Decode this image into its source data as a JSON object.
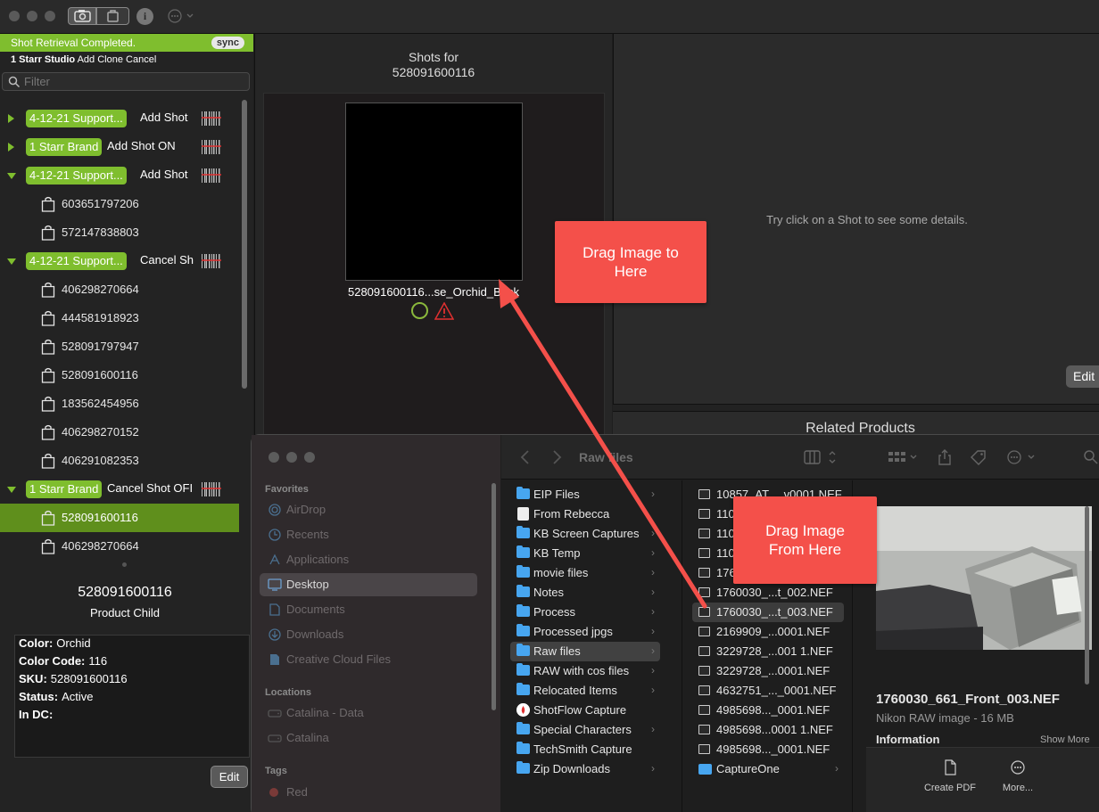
{
  "left": {
    "status": "Shot Retrieval Completed.",
    "sync_label": "sync",
    "studio": {
      "name": "1 Starr Studio",
      "add": "Add",
      "clone": "Clone",
      "cancel": "Cancel"
    },
    "filter_placeholder": "Filter",
    "tree": [
      {
        "type": "group",
        "badge": "4-12-21 Support...",
        "action": "Add Shot",
        "open": false
      },
      {
        "type": "group",
        "badge": "1 Starr Brand",
        "action": "Add Shot ON",
        "open": false
      },
      {
        "type": "group",
        "badge": "4-12-21 Support...",
        "action": "Add Shot",
        "open": true
      },
      {
        "type": "item",
        "sku": "603651797206"
      },
      {
        "type": "item",
        "sku": "572147838803"
      },
      {
        "type": "group",
        "badge": "4-12-21 Support...",
        "action": "Cancel Sh",
        "open": true
      },
      {
        "type": "item",
        "sku": "406298270664"
      },
      {
        "type": "item",
        "sku": "444581918923"
      },
      {
        "type": "item",
        "sku": "528091797947"
      },
      {
        "type": "item",
        "sku": "528091600116"
      },
      {
        "type": "item",
        "sku": "183562454956"
      },
      {
        "type": "item",
        "sku": "406298270152"
      },
      {
        "type": "item",
        "sku": "406291082353"
      },
      {
        "type": "group",
        "badge": "1 Starr Brand",
        "action": "Cancel Shot OFI",
        "open": true
      },
      {
        "type": "item",
        "sku": "528091600116",
        "selected": true
      },
      {
        "type": "item",
        "sku": "406298270664"
      }
    ],
    "detail": {
      "title": "528091600116",
      "subtitle": "Product Child",
      "fields": [
        {
          "k": "Color:",
          "v": "Orchid"
        },
        {
          "k": "Color Code:",
          "v": "116"
        },
        {
          "k": "SKU:",
          "v": "528091600116"
        },
        {
          "k": "Status:",
          "v": "Active"
        },
        {
          "k": "In DC:",
          "v": ""
        }
      ],
      "edit_label": "Edit"
    }
  },
  "middle": {
    "title_line1": "Shots for",
    "title_line2": "528091600116",
    "thumb_label": "528091600116...se_Orchid_Back"
  },
  "right": {
    "hint": "Try click on a Shot to see some details.",
    "edit_label": "Edit",
    "related_title": "Related Products"
  },
  "finder": {
    "title": "Raw files",
    "sidebar": {
      "favorites_label": "Favorites",
      "favorites": [
        {
          "label": "AirDrop",
          "icon": "airdrop-icon"
        },
        {
          "label": "Recents",
          "icon": "clock-icon"
        },
        {
          "label": "Applications",
          "icon": "applications-icon"
        },
        {
          "label": "Desktop",
          "icon": "desktop-icon",
          "selected": true
        },
        {
          "label": "Documents",
          "icon": "document-icon"
        },
        {
          "label": "Downloads",
          "icon": "download-icon"
        },
        {
          "label": "Creative Cloud Files",
          "icon": "file-icon"
        }
      ],
      "locations_label": "Locations",
      "locations": [
        {
          "label": "Catalina - Data",
          "icon": "disk-icon"
        },
        {
          "label": "Catalina",
          "icon": "disk-icon"
        }
      ],
      "tags_label": "Tags",
      "tags": [
        {
          "label": "Red",
          "color": "#7a3a38"
        }
      ]
    },
    "col1": [
      {
        "label": "EIP Files",
        "kind": "folder",
        "chev": true
      },
      {
        "label": "From Rebecca",
        "kind": "doc",
        "chev": false
      },
      {
        "label": "KB Screen Captures",
        "kind": "folder",
        "chev": true
      },
      {
        "label": "KB Temp",
        "kind": "folder",
        "chev": true
      },
      {
        "label": "movie files",
        "kind": "folder",
        "chev": true
      },
      {
        "label": "Notes",
        "kind": "folder",
        "chev": true
      },
      {
        "label": "Process",
        "kind": "folder",
        "chev": true
      },
      {
        "label": "Processed jpgs",
        "kind": "folder",
        "chev": true
      },
      {
        "label": "Raw files",
        "kind": "folder",
        "chev": true,
        "selected": true
      },
      {
        "label": "RAW with cos files",
        "kind": "folder",
        "chev": true
      },
      {
        "label": "Relocated Items",
        "kind": "folder",
        "chev": true
      },
      {
        "label": "ShotFlow Capture",
        "kind": "app",
        "chev": false
      },
      {
        "label": "Special Characters",
        "kind": "folder",
        "chev": true
      },
      {
        "label": "TechSmith Capture",
        "kind": "folder",
        "chev": false
      },
      {
        "label": "Zip Downloads",
        "kind": "folder",
        "chev": true
      }
    ],
    "col2": [
      {
        "label": "10857_AT..._v0001.NEF",
        "kind": "file"
      },
      {
        "label": "1105",
        "kind": "file"
      },
      {
        "label": "1105",
        "kind": "file"
      },
      {
        "label": "1105",
        "kind": "file"
      },
      {
        "label": "1760",
        "kind": "file"
      },
      {
        "label": "1760030_...t_002.NEF",
        "kind": "file"
      },
      {
        "label": "1760030_...t_003.NEF",
        "kind": "file",
        "selected": true
      },
      {
        "label": "2169909_...0001.NEF",
        "kind": "file"
      },
      {
        "label": "3229728_...001 1.NEF",
        "kind": "file"
      },
      {
        "label": "3229728_...0001.NEF",
        "kind": "file"
      },
      {
        "label": "4632751_..._0001.NEF",
        "kind": "file"
      },
      {
        "label": "4985698..._0001.NEF",
        "kind": "file"
      },
      {
        "label": "4985698...0001 1.NEF",
        "kind": "file"
      },
      {
        "label": "4985698..._0001.NEF",
        "kind": "file"
      },
      {
        "label": "CaptureOne",
        "kind": "folder"
      }
    ],
    "preview": {
      "name": "1760030_661_Front_003.NEF",
      "type": "Nikon RAW image - 16 MB",
      "info_label": "Information",
      "show_more": "Show More",
      "actions": [
        "Create PDF",
        "More..."
      ]
    }
  },
  "annotations": {
    "to_here": "Drag Image to Here",
    "from_here": "Drag Image From Here",
    "color": "#f4504a"
  }
}
